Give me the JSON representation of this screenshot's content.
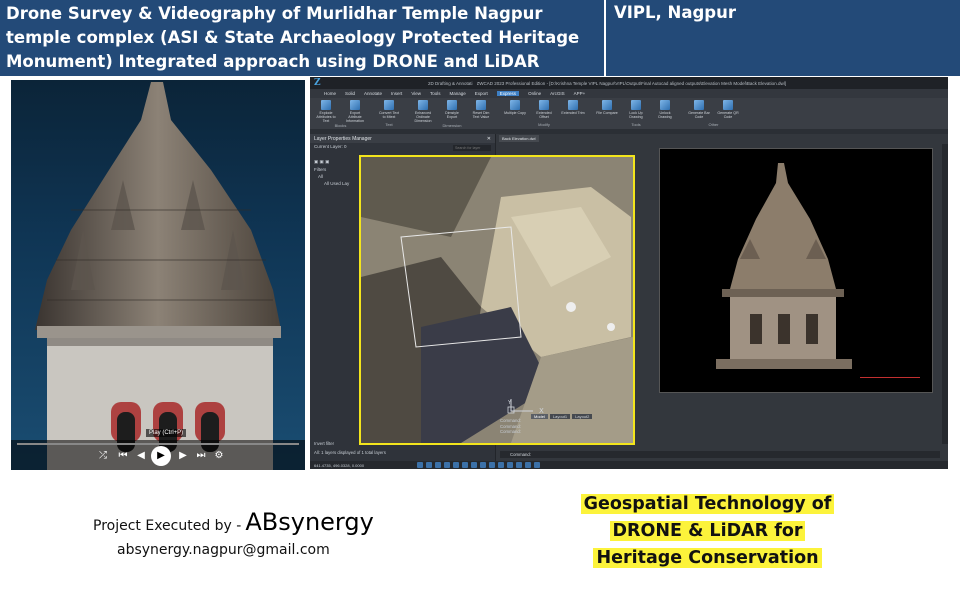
{
  "header": {
    "title_line1": "Drone Survey & Videography of Murlidhar Temple Nagpur",
    "title_line2": "temple complex (ASI & State Archaeology Protected Heritage",
    "title_line3": "Monument) Integrated approach using DRONE and LiDAR",
    "client": "VIPL, Nagpur"
  },
  "colors": {
    "header_bg": "#234a78",
    "highlight": "#fcf33b",
    "viewport_border": "#f3e51c",
    "cad_bg": "#2b2f35"
  },
  "video_player": {
    "tooltip": "Play (Ctrl+P)",
    "icons": [
      "shuffle-icon",
      "previous-icon",
      "rewind-icon",
      "play-icon",
      "forward-icon",
      "next-icon",
      "settings-icon"
    ]
  },
  "cad": {
    "title": "ZWCAD 2023 Professional Edition - [D:\\Krishna Temple VIPL Nagpur\\VIPL\\Output\\Final Autocad aligned outputs\\Elevation Mesh Model\\Back Elevation.dwl]",
    "workspace": "2D Drafting & Annotati",
    "menus": [
      "Home",
      "Solid",
      "Annotate",
      "Insert",
      "View",
      "Tools",
      "Manage",
      "Export",
      "Express",
      "Online",
      "ArcGIS",
      "APP+"
    ],
    "active_menu": "Express",
    "ribbon_groups": [
      {
        "name": "Blocks",
        "tools": [
          "Explode Attributes to Text",
          "Export Attribute Information"
        ]
      },
      {
        "name": "Text",
        "tools": [
          "Convert Text to Mtext"
        ]
      },
      {
        "name": "Dimension",
        "tools": [
          "Enhanced Ordinate Dimension",
          "Dimstyle Export",
          "Reset Dim Text Value"
        ]
      },
      {
        "name": "Modify",
        "tools": [
          "Multiple Copy",
          "Extended Offset",
          "Extended Trim"
        ]
      },
      {
        "name": "Tools",
        "tools": [
          "File Compare",
          "Lock Up Drawing",
          "Unlock Drawing"
        ]
      },
      {
        "name": "Other",
        "tools": [
          "Generate Bar Code",
          "Generate QR Code"
        ]
      }
    ],
    "layer_panel": {
      "title": "Layer Properties Manager",
      "current_layer": "Current Layer: 0",
      "search": "Search for layer",
      "filters": "Filters",
      "all_item": "All",
      "used_item": "All Used Lay",
      "invert": "Invert filter",
      "footer": "All: 1 layers displayed of 1 total layers"
    },
    "doc_tab": "Back Elevation.dwl",
    "layout_tabs": [
      "Model",
      "Layout1",
      "Layout2"
    ],
    "command_lines": [
      "Command:",
      "Command:",
      "Command:"
    ],
    "command_prompt": "Command:",
    "coords": "641.4735, 496.0328, 0.0000",
    "axis_x": "X",
    "axis_y": "Y"
  },
  "footer": {
    "executed_by": "Project Executed by -",
    "brand": "ABsynergy",
    "email": "absynergy.nagpur@gmail.com",
    "geo_line1": "Geospatial Technology of",
    "geo_line2": "DRONE & LiDAR for",
    "geo_line3": "Heritage Conservation"
  }
}
